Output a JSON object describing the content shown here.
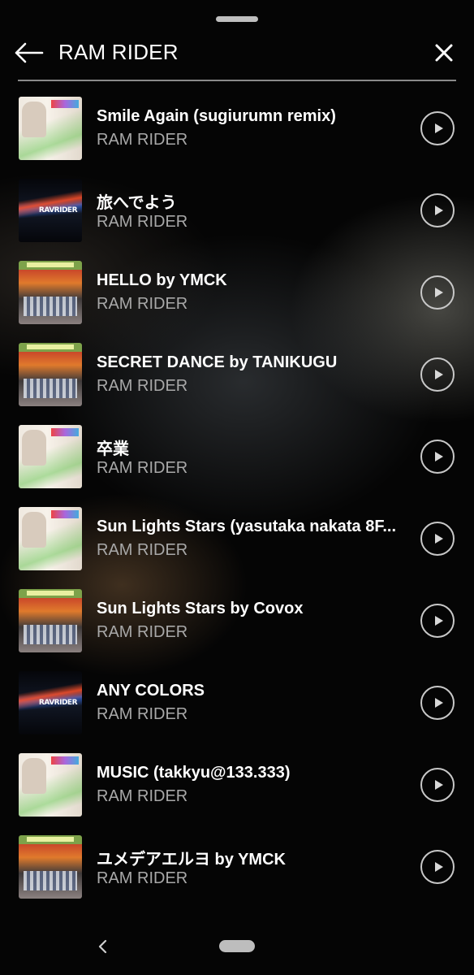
{
  "header": {
    "title": "RAM RIDER"
  },
  "icons": {
    "back": "arrow-left-icon",
    "close": "close-icon",
    "play": "play-circle-icon",
    "nav_back": "chevron-left-icon"
  },
  "colors": {
    "background": "#000000",
    "title_text": "#ffffff",
    "artist_text": "#a8a8a8",
    "divider": "#8a8a8a"
  },
  "tracks": [
    {
      "title": "Smile Again (sugiurumn remix)",
      "artist": "RAM RIDER"
    },
    {
      "title": "旅へでよう",
      "artist": "RAM RIDER"
    },
    {
      "title": "HELLO by YMCK",
      "artist": "RAM RIDER"
    },
    {
      "title": "SECRET DANCE by TANIKUGU",
      "artist": "RAM RIDER"
    },
    {
      "title": "卒業",
      "artist": "RAM RIDER"
    },
    {
      "title": "Sun Lights Stars (yasutaka nakata 8F...",
      "artist": "RAM RIDER"
    },
    {
      "title": "Sun Lights Stars by Covox",
      "artist": "RAM RIDER"
    },
    {
      "title": "ANY COLORS",
      "artist": "RAM RIDER"
    },
    {
      "title": "MUSIC (takkyu@133.333)",
      "artist": "RAM RIDER"
    },
    {
      "title": "ユメデアエルヨ by YMCK",
      "artist": "RAM RIDER"
    }
  ]
}
